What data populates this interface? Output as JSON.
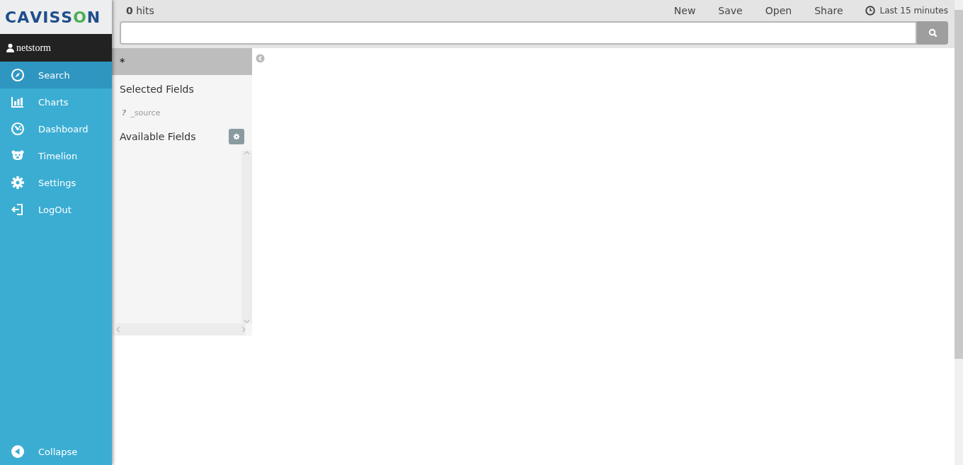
{
  "logo": {
    "text": "CAVISSON"
  },
  "user": {
    "name": "netstorm"
  },
  "nav": [
    {
      "label": "Search",
      "selected": true
    },
    {
      "label": "Charts",
      "selected": false
    },
    {
      "label": "Dashboard",
      "selected": false
    },
    {
      "label": "Timelion",
      "selected": false
    },
    {
      "label": "Settings",
      "selected": false
    },
    {
      "label": "LogOut",
      "selected": false
    }
  ],
  "collapse": {
    "label": "Collapse"
  },
  "toolbar": {
    "hits_count": "0",
    "hits_label": "hits",
    "actions": [
      "New",
      "Save",
      "Open",
      "Share"
    ],
    "time_range": "Last 15 minutes"
  },
  "fields_panel": {
    "index_pattern": "*",
    "selected_heading": "Selected Fields",
    "selected_fields": [
      {
        "type": "?",
        "name": "_source"
      }
    ],
    "available_heading": "Available Fields"
  }
}
